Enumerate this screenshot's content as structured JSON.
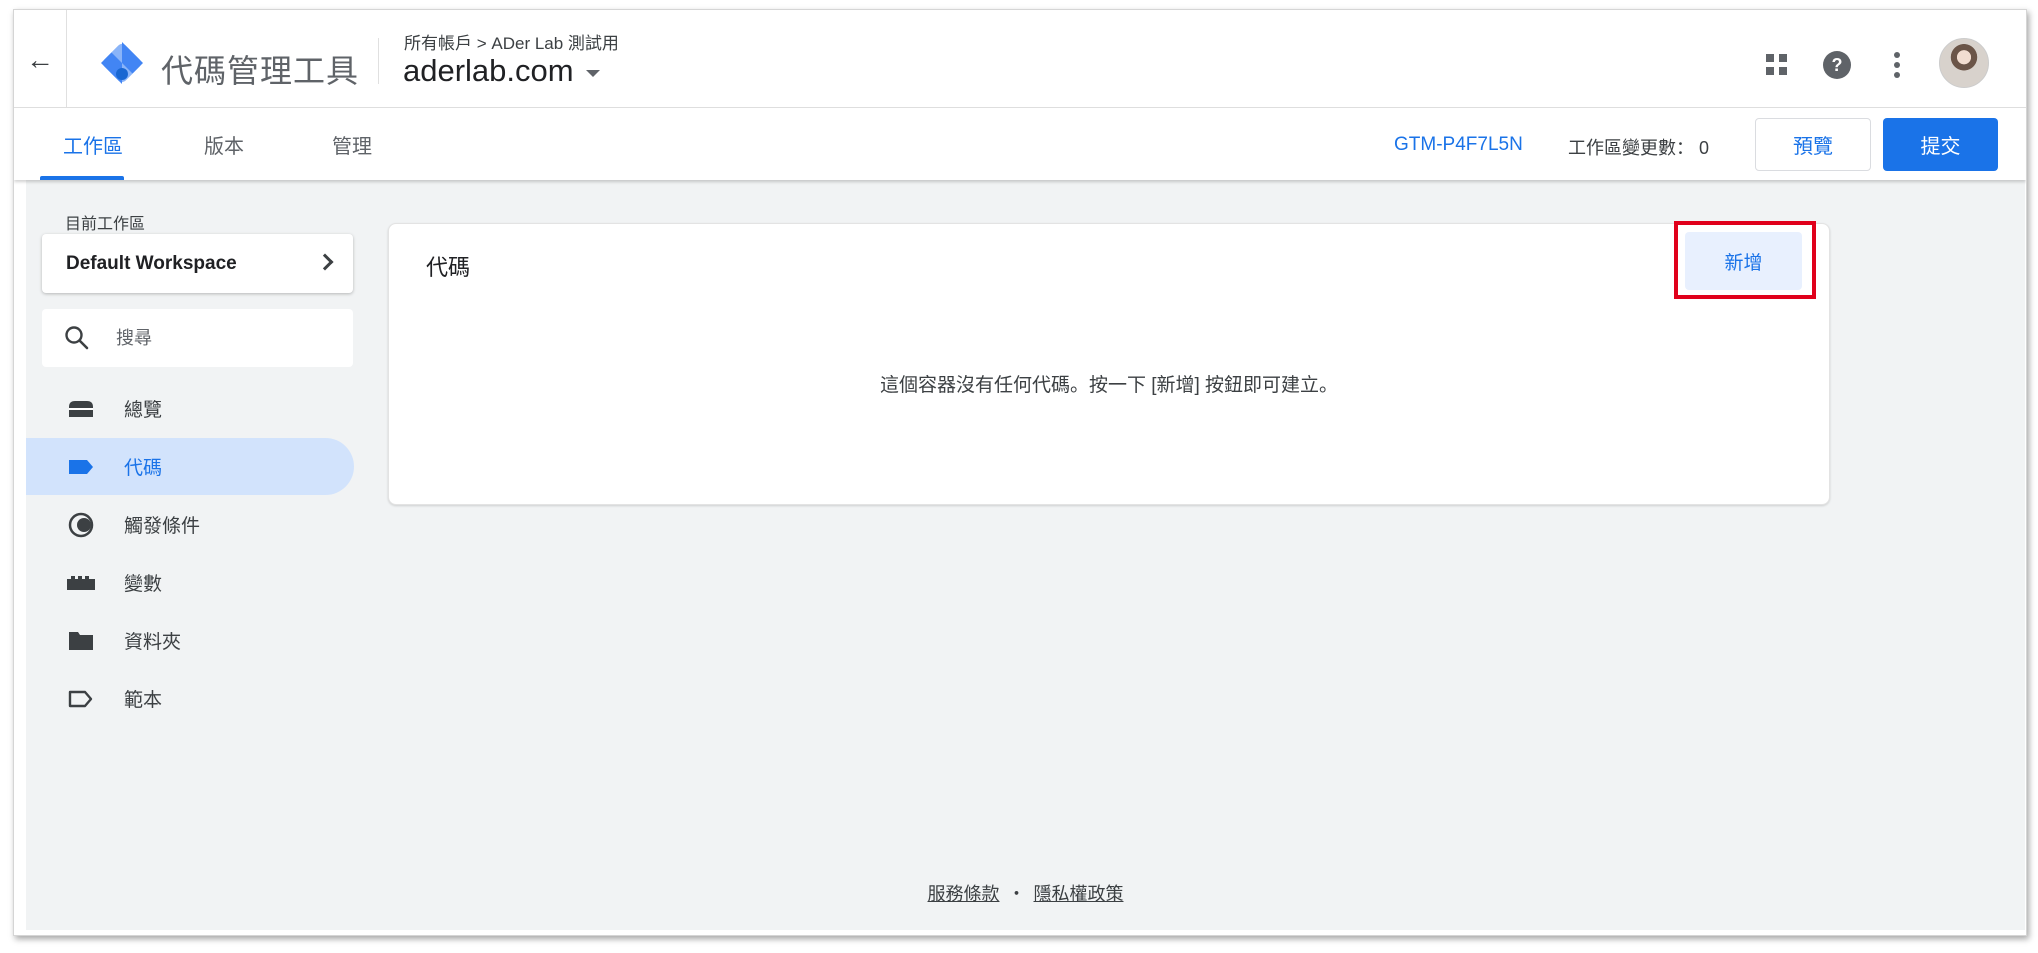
{
  "header": {
    "back_icon": "arrow-back-icon",
    "product_name": "代碼管理工具",
    "breadcrumb": "所有帳戶 > ADer Lab 測試用",
    "container_name": "aderlab.com",
    "icons": [
      "apps-icon",
      "help-icon",
      "more-vert-icon"
    ]
  },
  "tabs": [
    {
      "label": "工作區",
      "active": true
    },
    {
      "label": "版本",
      "active": false
    },
    {
      "label": "管理",
      "active": false
    }
  ],
  "toolbar": {
    "container_id": "GTM-P4F7L5N",
    "changes_label": "工作區變更數： 0",
    "preview_label": "預覽",
    "submit_label": "提交"
  },
  "sidebar": {
    "workspace_label": "目前工作區",
    "workspace_name": "Default Workspace",
    "search_placeholder": "搜尋",
    "items": [
      {
        "label": "總覽",
        "icon": "overview-icon",
        "active": false
      },
      {
        "label": "代碼",
        "icon": "tag-icon",
        "active": true
      },
      {
        "label": "觸發條件",
        "icon": "trigger-icon",
        "active": false
      },
      {
        "label": "變數",
        "icon": "variables-icon",
        "active": false
      },
      {
        "label": "資料夾",
        "icon": "folder-icon",
        "active": false
      },
      {
        "label": "範本",
        "icon": "template-icon",
        "active": false
      }
    ]
  },
  "main": {
    "card_title": "代碼",
    "new_label": "新增",
    "empty_message": "這個容器沒有任何代碼。按一下 [新增] 按鈕即可建立。"
  },
  "footer": {
    "terms": "服務條款",
    "separator": "・",
    "privacy": "隱私權政策"
  },
  "colors": {
    "accent": "#1a73e8",
    "active_nav_bg": "#d2e3fc",
    "highlight_box": "#e0001b",
    "content_bg": "#f1f3f4"
  }
}
